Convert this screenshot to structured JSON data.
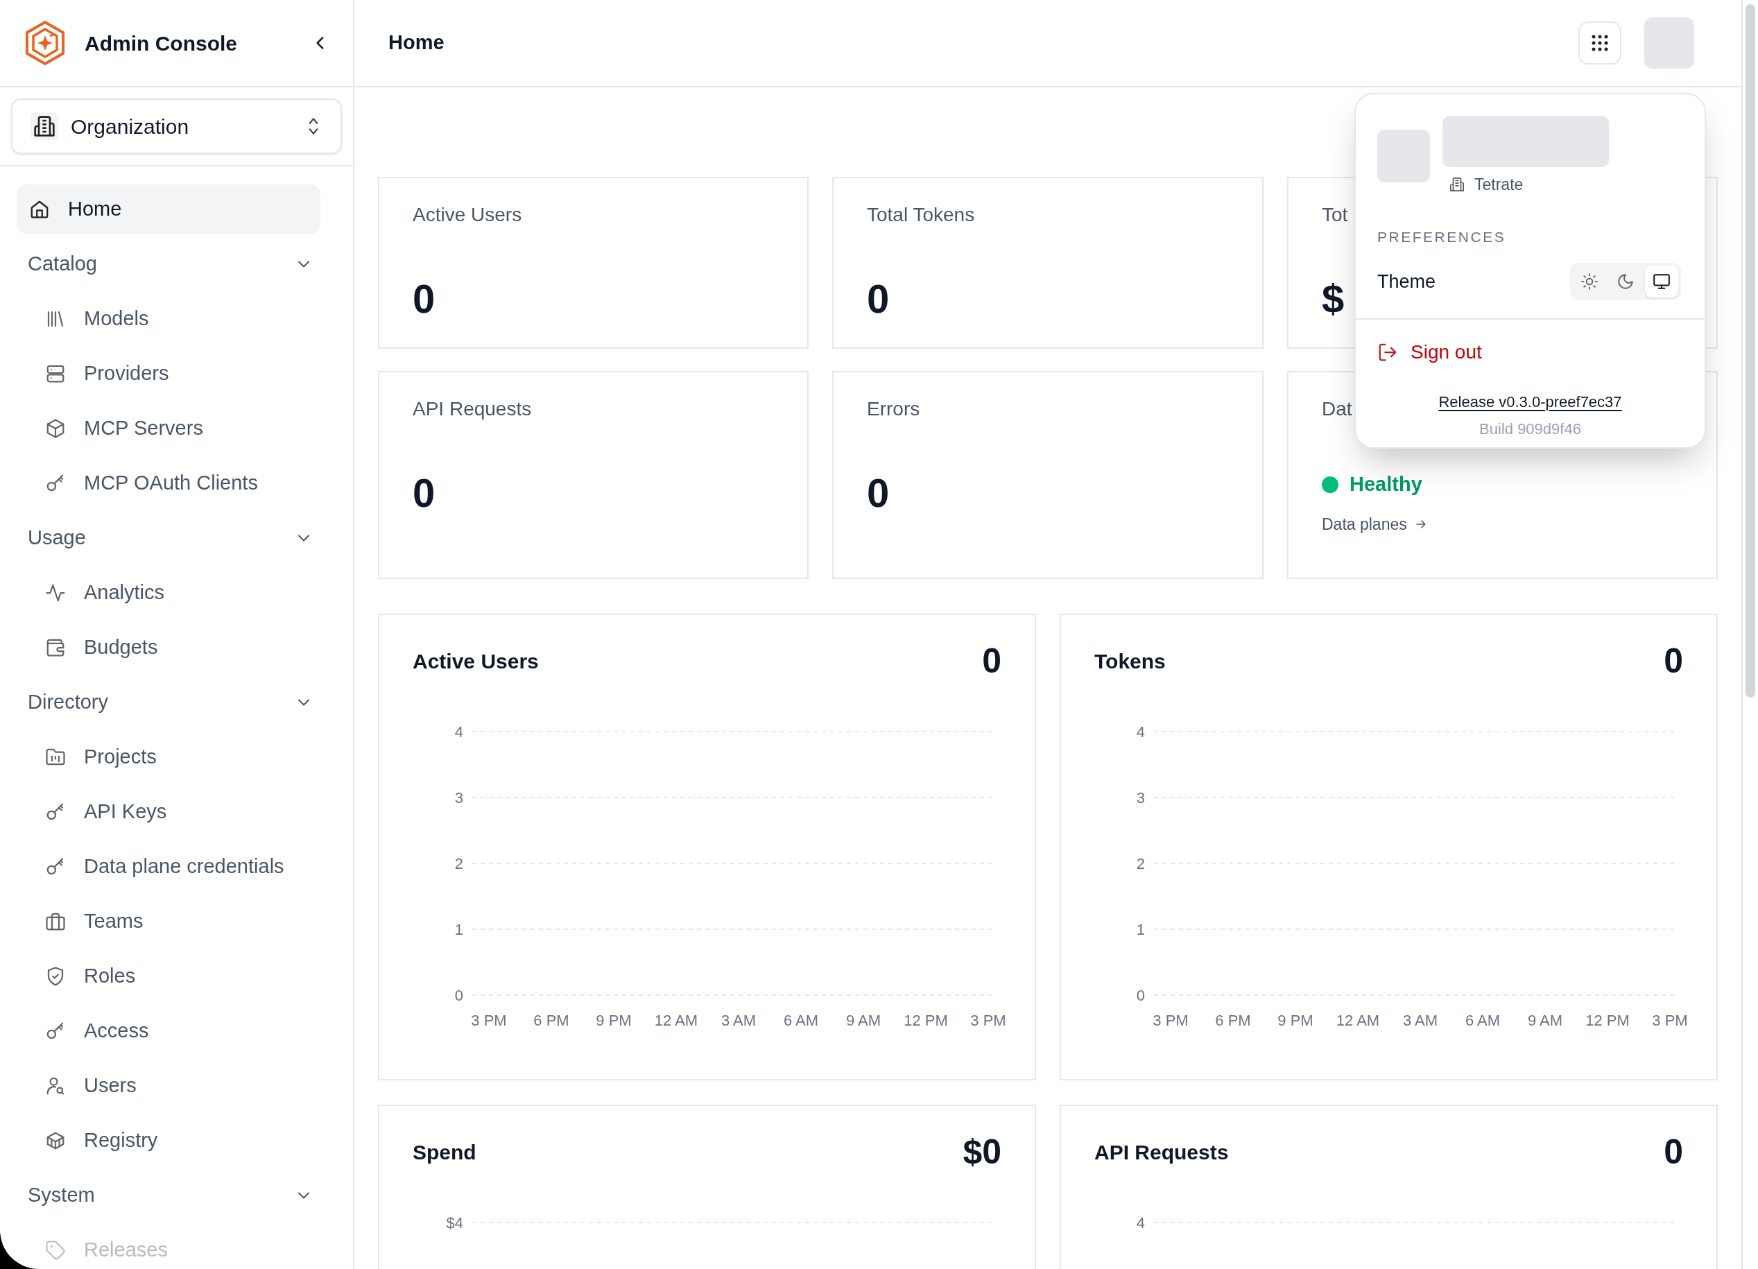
{
  "sidebar": {
    "title": "Admin Console",
    "org": {
      "label": "Organization"
    },
    "nav": [
      {
        "kind": "link",
        "label": "Home",
        "selected": true
      },
      {
        "kind": "section",
        "label": "Catalog",
        "expanded": true,
        "children": [
          {
            "label": "Models",
            "selected": false
          },
          {
            "label": "Providers",
            "selected": false
          },
          {
            "label": "MCP Servers",
            "selected": false
          },
          {
            "label": "MCP OAuth Clients",
            "selected": false
          }
        ]
      },
      {
        "kind": "section",
        "label": "Usage",
        "expanded": true,
        "children": [
          {
            "label": "Analytics",
            "selected": false
          },
          {
            "label": "Budgets",
            "selected": false
          }
        ]
      },
      {
        "kind": "section",
        "label": "Directory",
        "expanded": true,
        "children": [
          {
            "label": "Projects",
            "selected": false
          },
          {
            "label": "API Keys",
            "selected": false
          },
          {
            "label": "Data plane credentials",
            "selected": false
          },
          {
            "label": "Teams",
            "selected": false
          },
          {
            "label": "Roles",
            "selected": false
          },
          {
            "label": "Access",
            "selected": false
          },
          {
            "label": "Users",
            "selected": false
          },
          {
            "label": "Registry",
            "selected": false
          }
        ]
      },
      {
        "kind": "section",
        "label": "System",
        "expanded": true,
        "children": [
          {
            "label": "Releases",
            "selected": false
          }
        ]
      }
    ]
  },
  "header": {
    "title": "Home"
  },
  "stats": [
    {
      "kind": "number",
      "title": "Active Users",
      "value": "0"
    },
    {
      "kind": "number",
      "title": "Total Tokens",
      "value": "0"
    },
    {
      "kind": "number",
      "title": "Tot",
      "value": "$"
    },
    {
      "kind": "number",
      "title": "API Requests",
      "value": "0"
    },
    {
      "kind": "number",
      "title": "Errors",
      "value": "0"
    },
    {
      "kind": "status",
      "title": "Dat",
      "status": "Healthy",
      "link": "Data planes"
    }
  ],
  "charts": [
    {
      "title": "Active Users",
      "value": "0",
      "chart_data": {
        "type": "line",
        "grid": true,
        "categories": [
          "3 PM",
          "6 PM",
          "9 PM",
          "12 AM",
          "3 AM",
          "6 AM",
          "9 AM",
          "12 PM",
          "3 PM"
        ],
        "ylim": [
          0,
          4
        ],
        "yticks": [
          0,
          1,
          2,
          3,
          4
        ]
      }
    },
    {
      "title": "Tokens",
      "value": "0",
      "chart_data": {
        "type": "line",
        "grid": true,
        "categories": [
          "3 PM",
          "6 PM",
          "9 PM",
          "12 AM",
          "3 AM",
          "6 AM",
          "9 AM",
          "12 PM",
          "3 PM"
        ],
        "ylim": [
          0,
          4
        ],
        "yticks": [
          0,
          1,
          2,
          3,
          4
        ]
      }
    },
    {
      "title": "Spend",
      "value": "$0",
      "axis_label": "$4"
    },
    {
      "title": "API Requests",
      "value": "0",
      "axis_label": "4"
    }
  ],
  "user_menu": {
    "organization": "Tetrate",
    "section": "PREFERENCES",
    "theme": {
      "label": "Theme",
      "options": [
        {
          "selected": false
        },
        {
          "selected": false
        },
        {
          "selected": true
        }
      ]
    },
    "sign_out": "Sign out",
    "release": "Release v0.3.0-preef7ec37",
    "build": "Build 909d9f46"
  }
}
